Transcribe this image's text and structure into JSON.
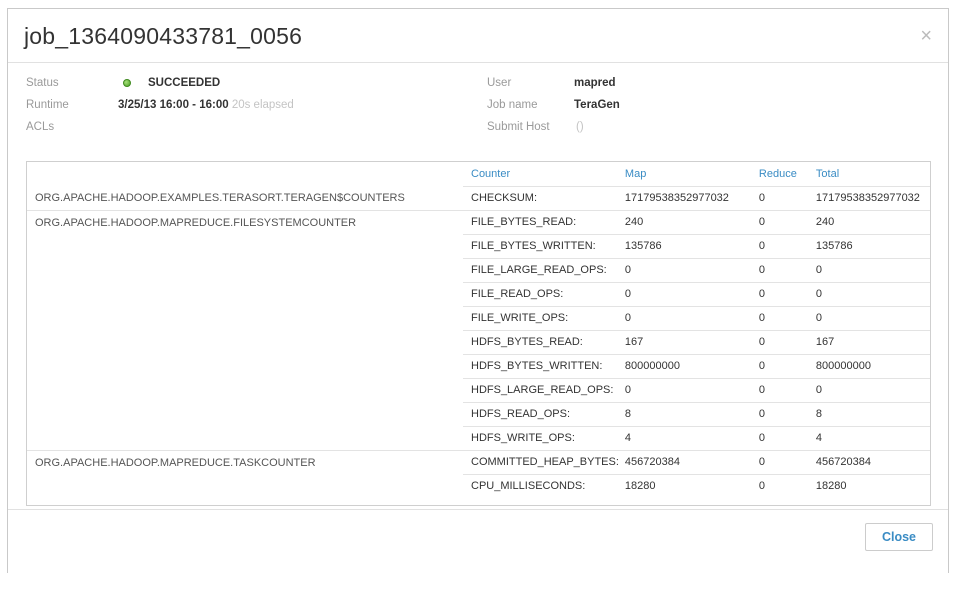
{
  "job_title": "job_1364090433781_0056",
  "close_symbol": "×",
  "meta": {
    "status_label": "Status",
    "status_value": "SUCCEEDED",
    "status_color": "#5cb531",
    "runtime_label": "Runtime",
    "runtime_value": "3/25/13 16:00 - 16:00",
    "runtime_elapsed": "20s elapsed",
    "acls_label": "ACLs",
    "user_label": "User",
    "user_value": "mapred",
    "jobname_label": "Job name",
    "jobname_value": "TeraGen",
    "submithost_label": "Submit Host",
    "submithost_value": "()"
  },
  "counters": {
    "headers": {
      "counter": "Counter",
      "map": "Map",
      "reduce": "Reduce",
      "total": "Total"
    },
    "groups": [
      {
        "name": "ORG.APACHE.HADOOP.EXAMPLES.TERASORT.TERAGEN$COUNTERS",
        "rows": [
          {
            "counter": "CHECKSUM:",
            "map": "17179538352977032",
            "reduce": "0",
            "total": "17179538352977032"
          }
        ]
      },
      {
        "name": "ORG.APACHE.HADOOP.MAPREDUCE.FILESYSTEMCOUNTER",
        "rows": [
          {
            "counter": "FILE_BYTES_READ:",
            "map": "240",
            "reduce": "0",
            "total": "240"
          },
          {
            "counter": "FILE_BYTES_WRITTEN:",
            "map": "135786",
            "reduce": "0",
            "total": "135786"
          },
          {
            "counter": "FILE_LARGE_READ_OPS:",
            "map": "0",
            "reduce": "0",
            "total": "0"
          },
          {
            "counter": "FILE_READ_OPS:",
            "map": "0",
            "reduce": "0",
            "total": "0"
          },
          {
            "counter": "FILE_WRITE_OPS:",
            "map": "0",
            "reduce": "0",
            "total": "0"
          },
          {
            "counter": "HDFS_BYTES_READ:",
            "map": "167",
            "reduce": "0",
            "total": "167"
          },
          {
            "counter": "HDFS_BYTES_WRITTEN:",
            "map": "800000000",
            "reduce": "0",
            "total": "800000000"
          },
          {
            "counter": "HDFS_LARGE_READ_OPS:",
            "map": "0",
            "reduce": "0",
            "total": "0"
          },
          {
            "counter": "HDFS_READ_OPS:",
            "map": "8",
            "reduce": "0",
            "total": "8"
          },
          {
            "counter": "HDFS_WRITE_OPS:",
            "map": "4",
            "reduce": "0",
            "total": "4"
          }
        ]
      },
      {
        "name": "ORG.APACHE.HADOOP.MAPREDUCE.TASKCOUNTER",
        "rows": [
          {
            "counter": "COMMITTED_HEAP_BYTES:",
            "map": "456720384",
            "reduce": "0",
            "total": "456720384"
          },
          {
            "counter": "CPU_MILLISECONDS:",
            "map": "18280",
            "reduce": "0",
            "total": "18280"
          }
        ]
      }
    ]
  },
  "footer": {
    "close_label": "Close"
  }
}
